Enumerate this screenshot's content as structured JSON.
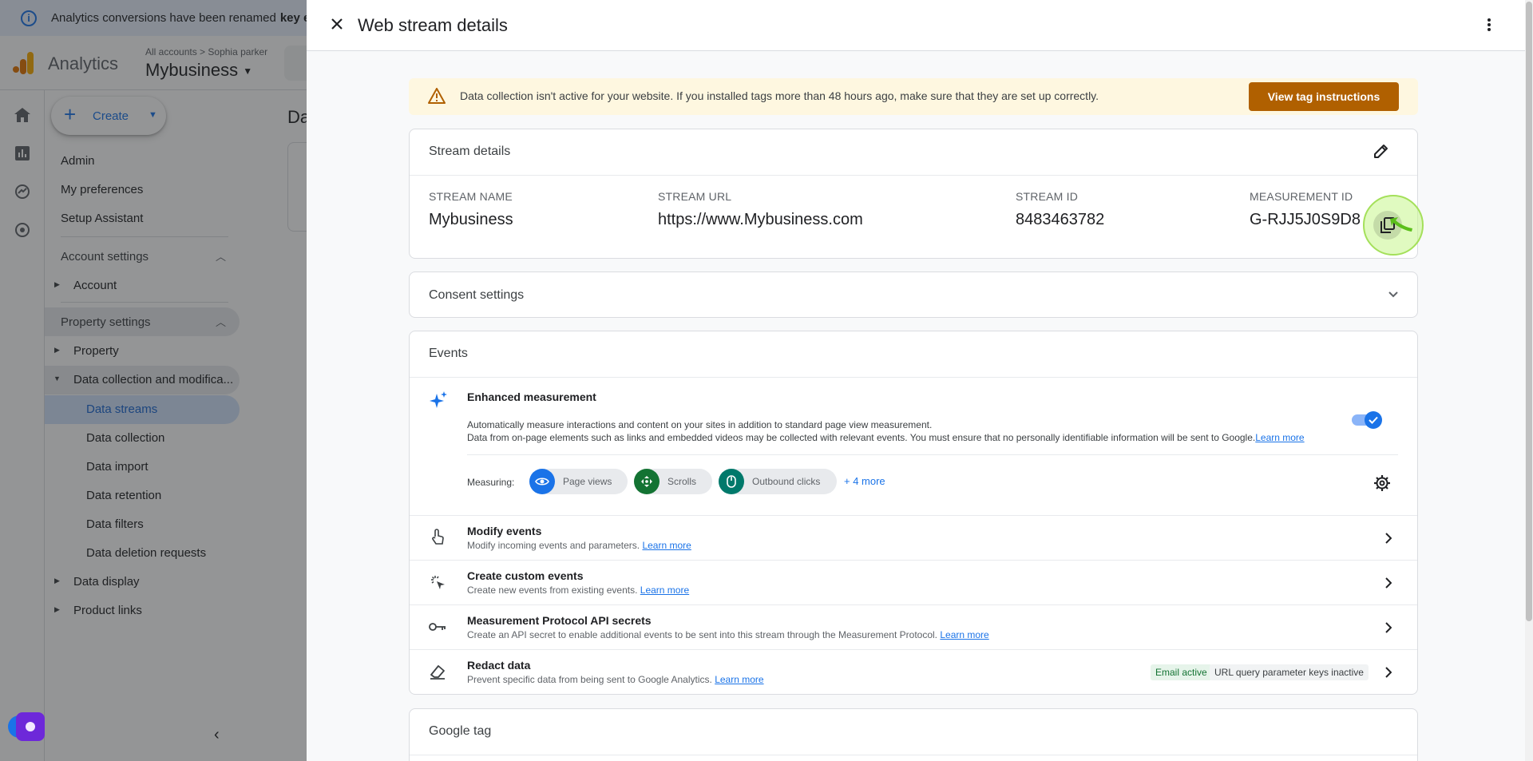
{
  "background": {
    "banner": {
      "text": "Analytics conversions have been renamed",
      "bold": "key eve"
    },
    "app_name": "Analytics",
    "breadcrumb": {
      "all_accounts": "All accounts",
      "separator": ">",
      "user": "Sophia parker"
    },
    "property_name": "Mybusiness",
    "create_label": "Create",
    "page_title_partial": "Da",
    "menu": {
      "admin": "Admin",
      "preferences": "My preferences",
      "setup": "Setup Assistant",
      "account_settings": "Account settings",
      "account": "Account",
      "property_settings": "Property settings",
      "property": "Property",
      "data_collection_mod": "Data collection and modifica...",
      "data_streams": "Data streams",
      "data_collection": "Data collection",
      "data_import": "Data import",
      "data_retention": "Data retention",
      "data_filters": "Data filters",
      "data_deletion": "Data deletion requests",
      "data_display": "Data display",
      "product_links": "Product links"
    }
  },
  "drawer": {
    "title": "Web stream details",
    "warning": {
      "text": "Data collection isn't active for your website. If you installed tags more than 48 hours ago, make sure that they are set up correctly.",
      "button": "View tag instructions"
    },
    "stream_details": {
      "title": "Stream details",
      "fields": [
        {
          "label": "STREAM NAME",
          "value": "Mybusiness"
        },
        {
          "label": "STREAM URL",
          "value": "https://www.Mybusiness.com"
        },
        {
          "label": "STREAM ID",
          "value": "8483463782"
        },
        {
          "label": "MEASUREMENT ID",
          "value": "G-RJJ5J0S9D8"
        }
      ]
    },
    "consent_title": "Consent settings",
    "events": {
      "title": "Events",
      "enhanced": {
        "title": "Enhanced measurement",
        "desc1": "Automatically measure interactions and content on your sites in addition to standard page view measurement.",
        "desc2": "Data from on-page elements such as links and embedded videos may be collected with relevant events. You must ensure that no personally identifiable information will be sent to Google.",
        "learn_more": "Learn more",
        "measuring_label": "Measuring:",
        "chips": [
          "Page views",
          "Scrolls",
          "Outbound clicks"
        ],
        "more": "+ 4 more"
      },
      "rows": [
        {
          "title": "Modify events",
          "desc": "Modify incoming events and parameters.",
          "link": "Learn more"
        },
        {
          "title": "Create custom events",
          "desc": "Create new events from existing events.",
          "link": "Learn more"
        },
        {
          "title": "Measurement Protocol API secrets",
          "desc": "Create an API secret to enable additional events to be sent into this stream through the Measurement Protocol.",
          "link": "Learn more"
        },
        {
          "title": "Redact data",
          "desc": "Prevent specific data from being sent to Google Analytics.",
          "link": "Learn more",
          "badge_active": "Email active",
          "badge_inactive": "URL query parameter keys inactive"
        }
      ]
    },
    "google_tag_title": "Google tag"
  },
  "colors": {
    "accent": "#1a73e8",
    "warn_button": "#b06000",
    "warn_bg": "#fef7e0",
    "toggle": "#1a73e8",
    "highlight": "#c6f68d"
  }
}
